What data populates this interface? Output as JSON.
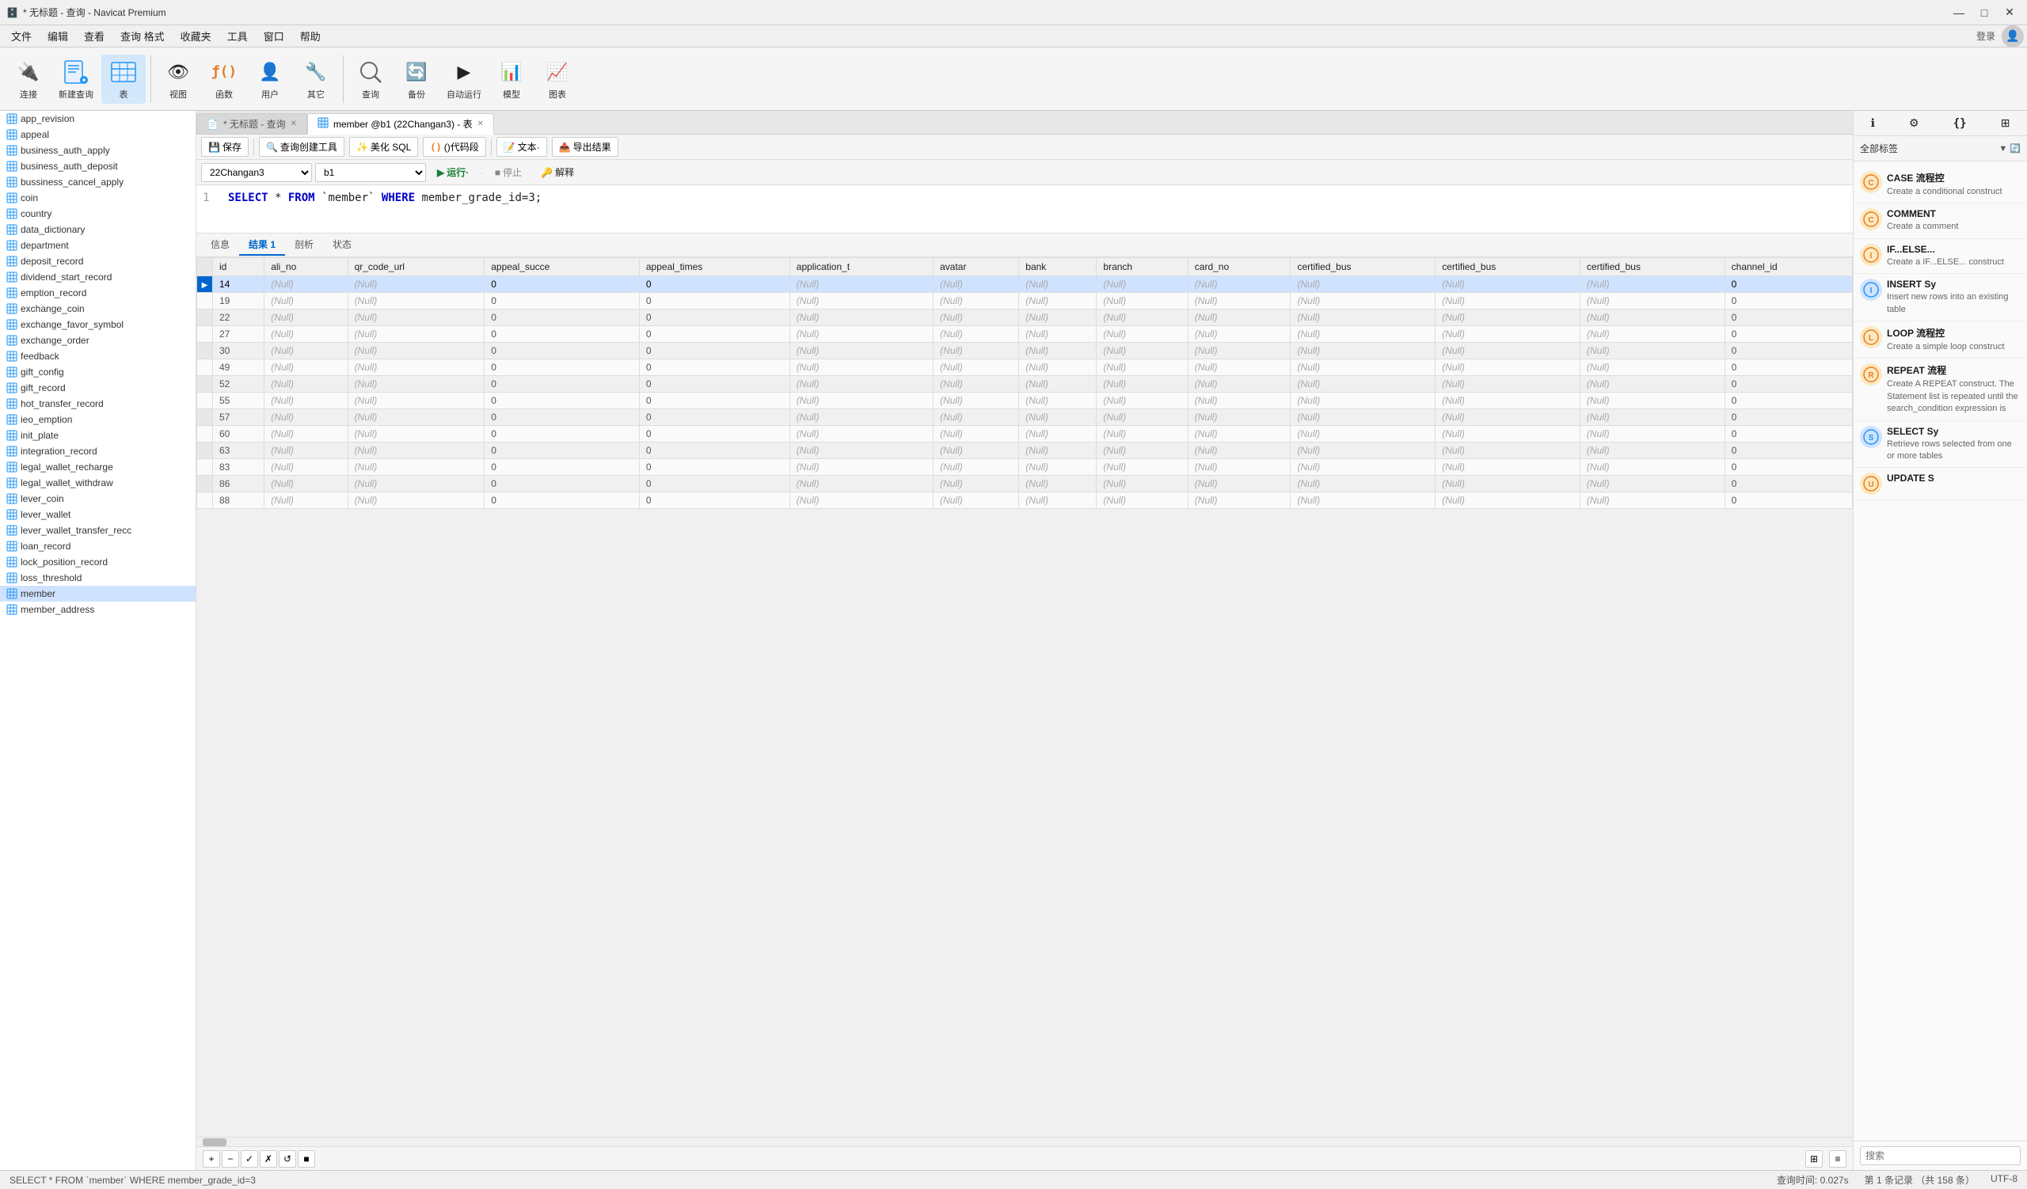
{
  "titlebar": {
    "title": "* 无标题 - 查询 - Navicat Premium",
    "icon": "🗄️"
  },
  "menubar": {
    "items": [
      "文件",
      "编辑",
      "查看",
      "查询 格式",
      "收藏夹",
      "工具",
      "窗口",
      "帮助"
    ]
  },
  "toolbar": {
    "items": [
      {
        "label": "连接",
        "icon": "🔌"
      },
      {
        "label": "新建查询",
        "icon": "📄"
      },
      {
        "label": "表",
        "icon": "⊞"
      },
      {
        "label": "视图",
        "icon": "👁"
      },
      {
        "label": "函数",
        "icon": "ƒ()"
      },
      {
        "label": "用户",
        "icon": "👤"
      },
      {
        "label": "其它",
        "icon": "🔧"
      },
      {
        "label": "查询",
        "icon": "🔍"
      },
      {
        "label": "备份",
        "icon": "🔄"
      },
      {
        "label": "自动运行",
        "icon": "▶"
      },
      {
        "label": "模型",
        "icon": "📊"
      },
      {
        "label": "图表",
        "icon": "📈"
      }
    ]
  },
  "sidebar": {
    "items": [
      "app_revision",
      "appeal",
      "business_auth_apply",
      "business_auth_deposit",
      "bussiness_cancel_apply",
      "coin",
      "country",
      "data_dictionary",
      "department",
      "deposit_record",
      "dividend_start_record",
      "emption_record",
      "exchange_coin",
      "exchange_favor_symbol",
      "exchange_order",
      "feedback",
      "gift_config",
      "gift_record",
      "hot_transfer_record",
      "ieo_emption",
      "init_plate",
      "integration_record",
      "legal_wallet_recharge",
      "legal_wallet_withdraw",
      "lever_coin",
      "lever_wallet",
      "lever_wallet_transfer_reco",
      "loan_record",
      "lock_position_record",
      "loss_threshold",
      "member",
      "member_address"
    ],
    "selected": "member"
  },
  "tabs": [
    {
      "label": "* 无标题 - 查询",
      "icon": "📄",
      "active": false
    },
    {
      "label": "member @b1 (22Changan3) - 表",
      "icon": "⊞",
      "active": true
    }
  ],
  "editor_toolbar": {
    "save": "保存",
    "build_query": "查询创建工具",
    "beautify": "美化 SQL",
    "code_snippet": "()代码段",
    "text": "文本·",
    "export": "导出结果"
  },
  "connection_bar": {
    "connection": "22Changan3",
    "database": "b1",
    "run": "运行·",
    "stop": "停止",
    "explain": "解释"
  },
  "query": {
    "line": 1,
    "sql": "SELECT * FROM `member` WHERE member_grade_id=3;"
  },
  "results_tabs": [
    "信息",
    "结果 1",
    "剖析",
    "状态"
  ],
  "active_result_tab": "结果 1",
  "table": {
    "columns": [
      "id",
      "ali_no",
      "qr_code_url",
      "appeal_succe",
      "appeal_times",
      "application_t",
      "avatar",
      "bank",
      "branch",
      "card_no",
      "certified_bus",
      "certified_bus",
      "certified_bus",
      "channel_id"
    ],
    "rows": [
      {
        "id": "14",
        "ali_no": "(Null)",
        "qr_code_url": "(Null)",
        "appeal_succe": "0",
        "appeal_times": "0",
        "application_t": "(Null)",
        "avatar": "(Null)",
        "bank": "(Null)",
        "branch": "(Null)",
        "card_no": "(Null)",
        "cert1": "(Null)",
        "cert2": "(Null)",
        "cert3": "(Null)",
        "channel_id": "0",
        "selected": true
      },
      {
        "id": "19",
        "ali_no": "(Null)",
        "qr_code_url": "(Null)",
        "appeal_succe": "0",
        "appeal_times": "0",
        "application_t": "(Null)",
        "avatar": "(Null)",
        "bank": "(Null)",
        "branch": "(Null)",
        "card_no": "(Null)",
        "cert1": "(Null)",
        "cert2": "(Null)",
        "cert3": "(Null)",
        "channel_id": "0"
      },
      {
        "id": "22",
        "ali_no": "(Null)",
        "qr_code_url": "(Null)",
        "appeal_succe": "0",
        "appeal_times": "0",
        "application_t": "(Null)",
        "avatar": "(Null)",
        "bank": "(Null)",
        "branch": "(Null)",
        "card_no": "(Null)",
        "cert1": "(Null)",
        "cert2": "(Null)",
        "cert3": "(Null)",
        "channel_id": "0"
      },
      {
        "id": "27",
        "ali_no": "(Null)",
        "qr_code_url": "(Null)",
        "appeal_succe": "0",
        "appeal_times": "0",
        "application_t": "(Null)",
        "avatar": "(Null)",
        "bank": "(Null)",
        "branch": "(Null)",
        "card_no": "(Null)",
        "cert1": "(Null)",
        "cert2": "(Null)",
        "cert3": "(Null)",
        "channel_id": "0"
      },
      {
        "id": "30",
        "ali_no": "(Null)",
        "qr_code_url": "(Null)",
        "appeal_succe": "0",
        "appeal_times": "0",
        "application_t": "(Null)",
        "avatar": "(Null)",
        "bank": "(Null)",
        "branch": "(Null)",
        "card_no": "(Null)",
        "cert1": "(Null)",
        "cert2": "(Null)",
        "cert3": "(Null)",
        "channel_id": "0"
      },
      {
        "id": "49",
        "ali_no": "(Null)",
        "qr_code_url": "(Null)",
        "appeal_succe": "0",
        "appeal_times": "0",
        "application_t": "(Null)",
        "avatar": "(Null)",
        "bank": "(Null)",
        "branch": "(Null)",
        "card_no": "(Null)",
        "cert1": "(Null)",
        "cert2": "(Null)",
        "cert3": "(Null)",
        "channel_id": "0"
      },
      {
        "id": "52",
        "ali_no": "(Null)",
        "qr_code_url": "(Null)",
        "appeal_succe": "0",
        "appeal_times": "0",
        "application_t": "(Null)",
        "avatar": "(Null)",
        "bank": "(Null)",
        "branch": "(Null)",
        "card_no": "(Null)",
        "cert1": "(Null)",
        "cert2": "(Null)",
        "cert3": "(Null)",
        "channel_id": "0"
      },
      {
        "id": "55",
        "ali_no": "(Null)",
        "qr_code_url": "(Null)",
        "appeal_succe": "0",
        "appeal_times": "0",
        "application_t": "(Null)",
        "avatar": "(Null)",
        "bank": "(Null)",
        "branch": "(Null)",
        "card_no": "(Null)",
        "cert1": "(Null)",
        "cert2": "(Null)",
        "cert3": "(Null)",
        "channel_id": "0"
      },
      {
        "id": "57",
        "ali_no": "(Null)",
        "qr_code_url": "(Null)",
        "appeal_succe": "0",
        "appeal_times": "0",
        "application_t": "(Null)",
        "avatar": "(Null)",
        "bank": "(Null)",
        "branch": "(Null)",
        "card_no": "(Null)",
        "cert1": "(Null)",
        "cert2": "(Null)",
        "cert3": "(Null)",
        "channel_id": "0"
      },
      {
        "id": "60",
        "ali_no": "(Null)",
        "qr_code_url": "(Null)",
        "appeal_succe": "0",
        "appeal_times": "0",
        "application_t": "(Null)",
        "avatar": "(Null)",
        "bank": "(Null)",
        "branch": "(Null)",
        "card_no": "(Null)",
        "cert1": "(Null)",
        "cert2": "(Null)",
        "cert3": "(Null)",
        "channel_id": "0"
      },
      {
        "id": "63",
        "ali_no": "(Null)",
        "qr_code_url": "(Null)",
        "appeal_succe": "0",
        "appeal_times": "0",
        "application_t": "(Null)",
        "avatar": "(Null)",
        "bank": "(Null)",
        "branch": "(Null)",
        "card_no": "(Null)",
        "cert1": "(Null)",
        "cert2": "(Null)",
        "cert3": "(Null)",
        "channel_id": "0"
      },
      {
        "id": "83",
        "ali_no": "(Null)",
        "qr_code_url": "(Null)",
        "appeal_succe": "0",
        "appeal_times": "0",
        "application_t": "(Null)",
        "avatar": "(Null)",
        "bank": "(Null)",
        "branch": "(Null)",
        "card_no": "(Null)",
        "cert1": "(Null)",
        "cert2": "(Null)",
        "cert3": "(Null)",
        "channel_id": "0"
      },
      {
        "id": "86",
        "ali_no": "(Null)",
        "qr_code_url": "(Null)",
        "appeal_succe": "0",
        "appeal_times": "0",
        "application_t": "(Null)",
        "avatar": "(Null)",
        "bank": "(Null)",
        "branch": "(Null)",
        "card_no": "(Null)",
        "cert1": "(Null)",
        "cert2": "(Null)",
        "cert3": "(Null)",
        "channel_id": "0"
      },
      {
        "id": "88",
        "ali_no": "(Null)",
        "qr_code_url": "(Null)",
        "appeal_succe": "0",
        "appeal_times": "0",
        "application_t": "(Null)",
        "avatar": "(Null)",
        "bank": "(Null)",
        "branch": "(Null)",
        "card_no": "(Null)",
        "cert1": "(Null)",
        "cert2": "(Null)",
        "cert3": "(Null)",
        "channel_id": "0"
      }
    ]
  },
  "bottom_bar": {
    "add": "+",
    "delete": "−",
    "check": "✓",
    "cancel": "✗",
    "refresh": "↺",
    "stop": "■"
  },
  "statusbar": {
    "sql": "SELECT * FROM `member` WHERE member_grade_id=3",
    "query_time": "查询时间: 0.027s",
    "records": "第 1 条记录 （共 158 条）",
    "encoding": "UTF-8"
  },
  "right_panel": {
    "header": "全部标签",
    "snippets": [
      {
        "title": "CASE 流程控",
        "desc": "Create a conditional construct",
        "icon_color": "#e8a020"
      },
      {
        "title": "COMMENT",
        "desc": "Create a comment",
        "icon_color": "#e8a020"
      },
      {
        "title": "IF...ELSE...",
        "desc": "Create a IF...ELSE... construct",
        "icon_color": "#e8a020"
      },
      {
        "title": "INSERT Sy",
        "desc": "Insert new rows into an existing table",
        "icon_color": "#e8a020"
      },
      {
        "title": "LOOP 流程控",
        "desc": "Create a simple loop construct",
        "icon_color": "#e8a020"
      },
      {
        "title": "REPEAT 流程",
        "desc": "Create A REPEAT construct. The Statement list is repeated until the search_condition expression is",
        "icon_color": "#e8a020"
      },
      {
        "title": "SELECT Sy",
        "desc": "Retrieve rows selected from one or more tables",
        "icon_color": "#e8a020"
      },
      {
        "title": "UPDATE S",
        "desc": "",
        "icon_color": "#e8a020"
      }
    ],
    "search_placeholder": "搜索"
  }
}
